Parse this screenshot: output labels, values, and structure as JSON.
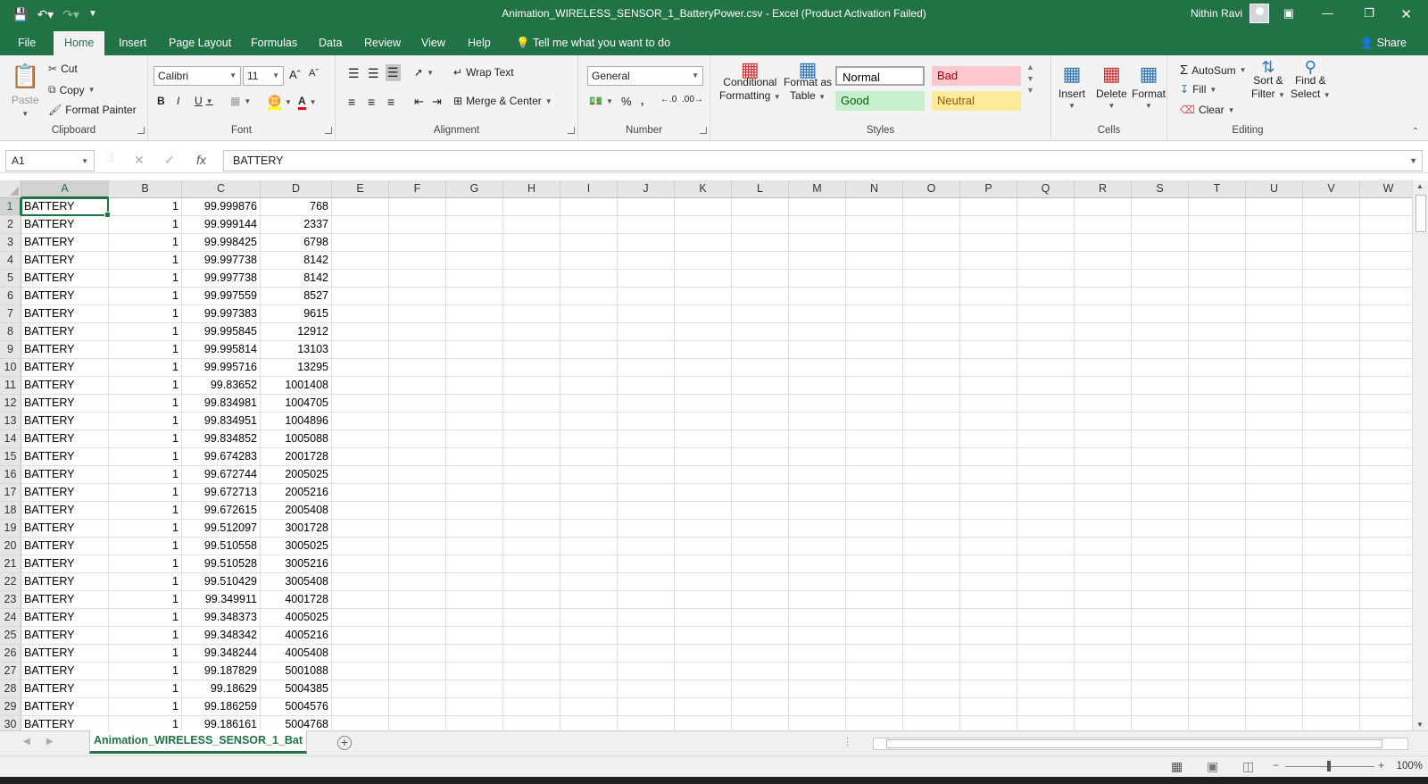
{
  "window": {
    "title": "Animation_WIRELESS_SENSOR_1_BatteryPower.csv  -  Excel (Product Activation Failed)",
    "user": "Nithin Ravi"
  },
  "ribbon_tabs": [
    "File",
    "Home",
    "Insert",
    "Page Layout",
    "Formulas",
    "Data",
    "Review",
    "View",
    "Help"
  ],
  "active_tab": "Home",
  "tell_me": "Tell me what you want to do",
  "share": "Share",
  "clipboard": {
    "paste": "Paste",
    "cut": "Cut",
    "copy": "Copy",
    "format_painter": "Format Painter",
    "label": "Clipboard"
  },
  "font": {
    "name": "Calibri",
    "size": "11",
    "label": "Font"
  },
  "alignment": {
    "wrap": "Wrap Text",
    "merge": "Merge & Center",
    "label": "Alignment"
  },
  "number": {
    "format": "General",
    "label": "Number"
  },
  "styles": {
    "conditional": "Conditional",
    "conditional2": "Formatting",
    "format_as": "Format as",
    "format_as2": "Table",
    "normal": "Normal",
    "bad": "Bad",
    "good": "Good",
    "neutral": "Neutral",
    "label": "Styles"
  },
  "cells": {
    "insert": "Insert",
    "delete": "Delete",
    "format": "Format",
    "label": "Cells"
  },
  "editing": {
    "autosum": "AutoSum",
    "fill": "Fill",
    "clear": "Clear",
    "sort": "Sort &",
    "sort2": "Filter",
    "find": "Find &",
    "find2": "Select",
    "label": "Editing"
  },
  "formula_bar": {
    "name_box": "A1",
    "value": "BATTERY"
  },
  "columns": [
    "A",
    "B",
    "C",
    "D",
    "E",
    "F",
    "G",
    "H",
    "I",
    "J",
    "K",
    "L",
    "M",
    "N",
    "O",
    "P",
    "Q",
    "R",
    "S",
    "T",
    "U",
    "V",
    "W"
  ],
  "rows": [
    [
      "BATTERY",
      "1",
      "99.999876",
      "768"
    ],
    [
      "BATTERY",
      "1",
      "99.999144",
      "2337"
    ],
    [
      "BATTERY",
      "1",
      "99.998425",
      "6798"
    ],
    [
      "BATTERY",
      "1",
      "99.997738",
      "8142"
    ],
    [
      "BATTERY",
      "1",
      "99.997738",
      "8142"
    ],
    [
      "BATTERY",
      "1",
      "99.997559",
      "8527"
    ],
    [
      "BATTERY",
      "1",
      "99.997383",
      "9615"
    ],
    [
      "BATTERY",
      "1",
      "99.995845",
      "12912"
    ],
    [
      "BATTERY",
      "1",
      "99.995814",
      "13103"
    ],
    [
      "BATTERY",
      "1",
      "99.995716",
      "13295"
    ],
    [
      "BATTERY",
      "1",
      "99.83652",
      "1001408"
    ],
    [
      "BATTERY",
      "1",
      "99.834981",
      "1004705"
    ],
    [
      "BATTERY",
      "1",
      "99.834951",
      "1004896"
    ],
    [
      "BATTERY",
      "1",
      "99.834852",
      "1005088"
    ],
    [
      "BATTERY",
      "1",
      "99.674283",
      "2001728"
    ],
    [
      "BATTERY",
      "1",
      "99.672744",
      "2005025"
    ],
    [
      "BATTERY",
      "1",
      "99.672713",
      "2005216"
    ],
    [
      "BATTERY",
      "1",
      "99.672615",
      "2005408"
    ],
    [
      "BATTERY",
      "1",
      "99.512097",
      "3001728"
    ],
    [
      "BATTERY",
      "1",
      "99.510558",
      "3005025"
    ],
    [
      "BATTERY",
      "1",
      "99.510528",
      "3005216"
    ],
    [
      "BATTERY",
      "1",
      "99.510429",
      "3005408"
    ],
    [
      "BATTERY",
      "1",
      "99.349911",
      "4001728"
    ],
    [
      "BATTERY",
      "1",
      "99.348373",
      "4005025"
    ],
    [
      "BATTERY",
      "1",
      "99.348342",
      "4005216"
    ],
    [
      "BATTERY",
      "1",
      "99.348244",
      "4005408"
    ],
    [
      "BATTERY",
      "1",
      "99.187829",
      "5001088"
    ],
    [
      "BATTERY",
      "1",
      "99.18629",
      "5004385"
    ],
    [
      "BATTERY",
      "1",
      "99.186259",
      "5004576"
    ],
    [
      "BATTERY",
      "1",
      "99.186161",
      "5004768"
    ]
  ],
  "sheet_tab": "Animation_WIRELESS_SENSOR_1_Bat",
  "zoom": "100%",
  "colors": {
    "accent": "#217346",
    "bad_bg": "#ffc7ce",
    "bad_fg": "#9c0006",
    "good_bg": "#c6efce",
    "good_fg": "#006100",
    "neutral_bg": "#ffeb9c",
    "neutral_fg": "#9c5700"
  }
}
